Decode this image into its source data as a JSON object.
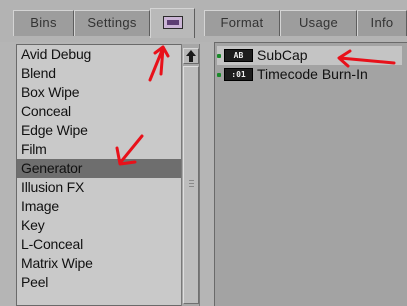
{
  "tabs": [
    {
      "label": "Bins"
    },
    {
      "label": "Settings"
    },
    {
      "label": "",
      "icon": "effects-palette-icon"
    },
    {
      "label": "Format"
    },
    {
      "label": "Usage"
    },
    {
      "label": "Info"
    }
  ],
  "categories": {
    "items": [
      "Avid Debug",
      "Blend",
      "Box Wipe",
      "Conceal",
      "Edge Wipe",
      "Film",
      "Generator",
      "Illusion FX",
      "Image",
      "Key",
      "L-Conceal",
      "Matrix Wipe",
      "Peel"
    ],
    "selected": "Generator"
  },
  "effects": [
    {
      "icon_text": "AB",
      "label": "SubCap"
    },
    {
      "icon_text": ":01",
      "label": "Timecode Burn-In"
    }
  ],
  "colors": {
    "annotation_arrow": "#e8111a",
    "status_dot": "#1a8a2a",
    "tab_icon_fill": "#cbb5d6"
  }
}
